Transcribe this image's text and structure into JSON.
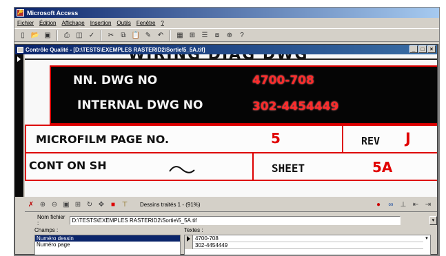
{
  "app": {
    "title": "Microsoft Access",
    "menu": [
      "Fichier",
      "Édition",
      "Affichage",
      "Insertion",
      "Outils",
      "Fenêtre",
      "?"
    ]
  },
  "toolbar": {
    "icons": [
      "new-icon",
      "open-icon",
      "save-icon",
      "print-icon",
      "print-preview-icon",
      "spellcheck-icon",
      "cut-icon",
      "copy-icon",
      "paste-icon",
      "format-painter-icon",
      "undo-icon",
      "view-icon",
      "insert-object-icon",
      "properties-icon",
      "relationships-icon",
      "new-object-icon",
      "help-icon"
    ]
  },
  "child_window": {
    "title": "Contrôle Qualité - [D:\\TESTS\\EXEMPLES RASTERID2\\Sortie\\5_5A.tif]"
  },
  "scan": {
    "top_text": "WIRING DIAG DWG",
    "nn_label": "NN. DWG NO",
    "nn_value": "4700-708",
    "internal_label": "INTERNAL DWG NO",
    "internal_value": "302-4454449",
    "microfilm_label": "MICROFILM PAGE NO.",
    "microfilm_value": "5",
    "rev_label": "REV",
    "rev_value": "J",
    "cont_label": "CONT ON SH",
    "sheet_label": "SHEET",
    "sheet_value": "5A"
  },
  "image_toolbar": {
    "status": "Dessins traités 1 - (91%)"
  },
  "form": {
    "filename_label": "Nom fichier :",
    "filename_value": "D:\\TESTS\\EXEMPLES RASTERID2\\Sortie\\5_5A.tif",
    "champs_label": "Champs :",
    "textes_label": "Textes :",
    "champs_items": [
      "Numéro dessin",
      "Numéro page"
    ],
    "textes_items": [
      "4700-708",
      "302-4454449"
    ]
  },
  "colors": {
    "annotation_red": "#e00000",
    "title_bar": "#0a246a"
  }
}
